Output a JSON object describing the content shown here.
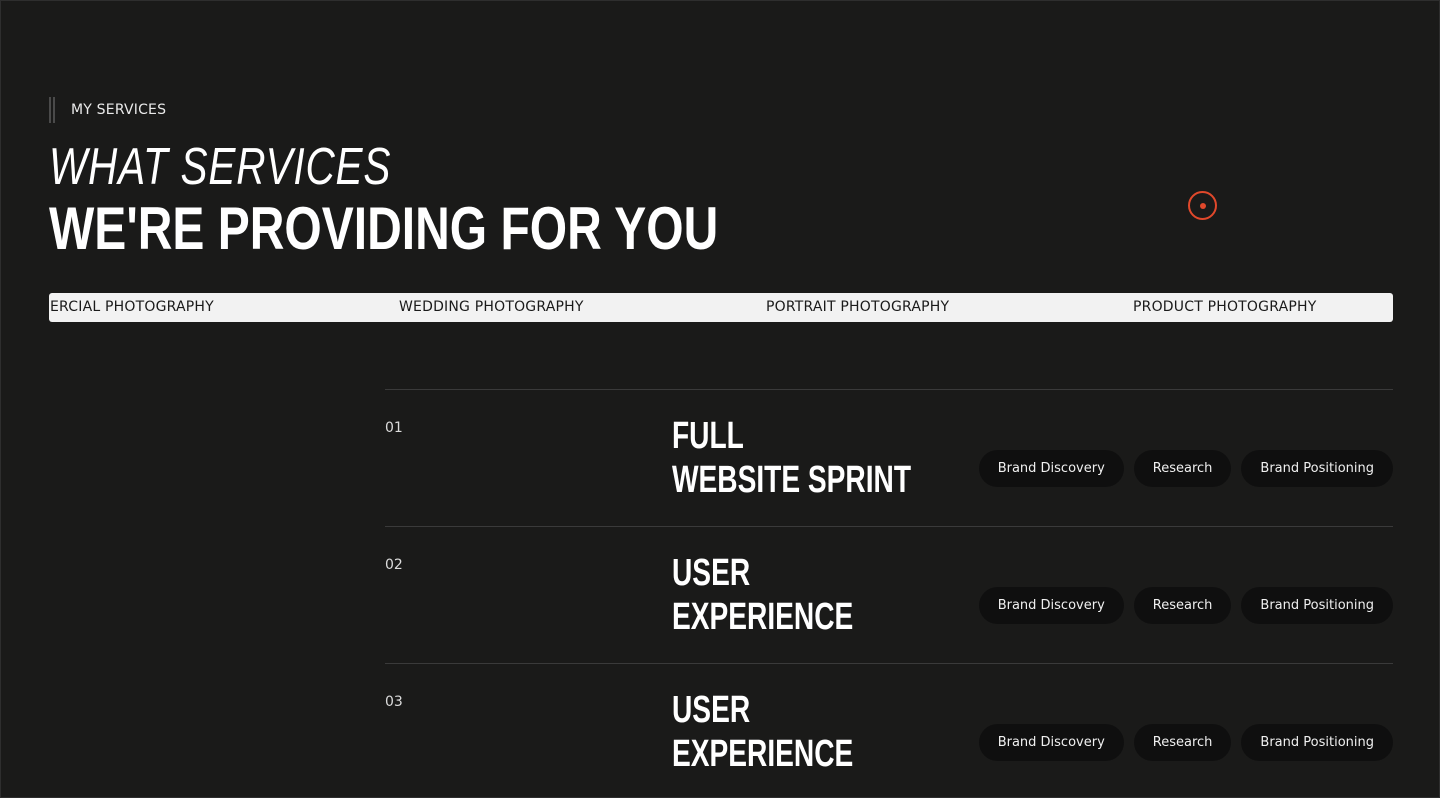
{
  "eyebrow": {
    "label": "MY SERVICES"
  },
  "headline": {
    "line1": "WHAT SERVICES",
    "line2": "WE'RE PROVIDING FOR YOU"
  },
  "marquee": {
    "items": [
      "ERCIAL PHOTOGRAPHY",
      "WEDDING PHOTOGRAPHY",
      "PORTRAIT PHOTOGRAPHY",
      "PRODUCT PHOTOGRAPHY"
    ]
  },
  "services": [
    {
      "number": "01",
      "title_line1": "FULL",
      "title_line2": "WEBSITE SPRINT",
      "tags": [
        "Brand Discovery",
        "Research",
        "Brand Positioning"
      ]
    },
    {
      "number": "02",
      "title_line1": "USER",
      "title_line2": "EXPERIENCE",
      "tags": [
        "Brand Discovery",
        "Research",
        "Brand Positioning"
      ]
    },
    {
      "number": "03",
      "title_line1": "USER",
      "title_line2": "EXPERIENCE",
      "tags": [
        "Brand Discovery",
        "Research",
        "Brand Positioning"
      ]
    }
  ],
  "colors": {
    "background": "#1a1a19",
    "accent": "#e0482b",
    "strip": "#f2f2f2",
    "tag_bg": "#0f0f0f"
  },
  "icons": {
    "cursor": "target-cursor-icon"
  }
}
